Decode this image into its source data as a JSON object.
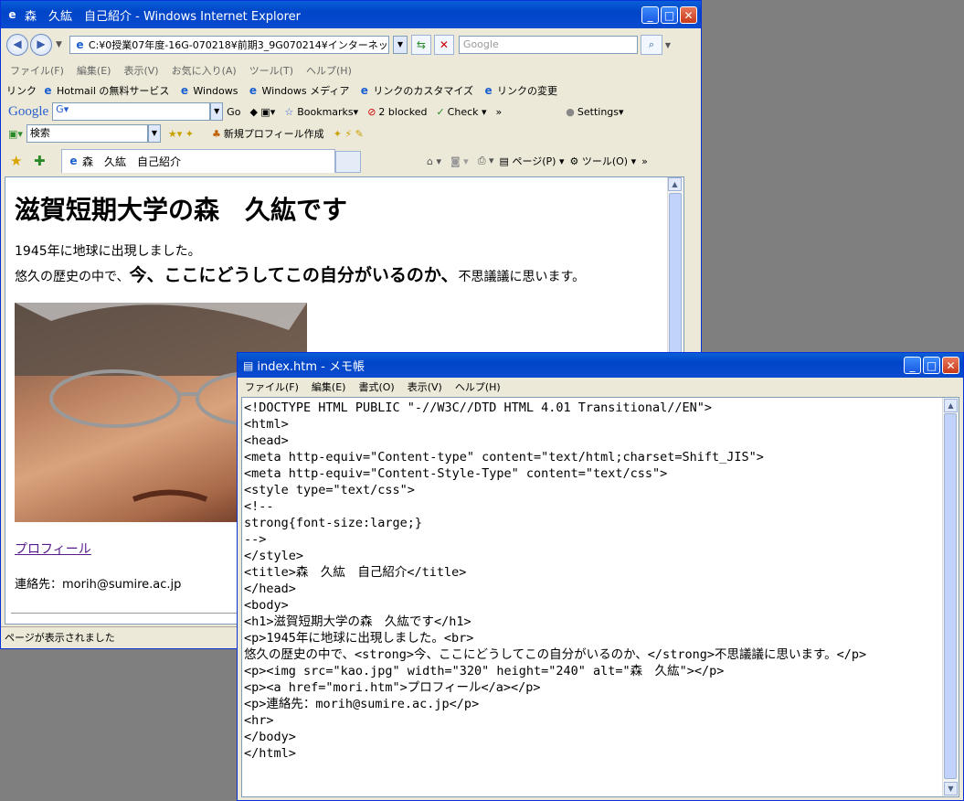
{
  "ie": {
    "title": "森　久紘　自己紹介 - Windows Internet Explorer",
    "address": "C:¥0授業07年度-16G-070218¥前期3_9G070214¥インターネット演習2",
    "search_placeholder": "Google",
    "menu": [
      "ファイル(F)",
      "編集(E)",
      "表示(V)",
      "お気に入り(A)",
      "ツール(T)",
      "ヘルプ(H)"
    ],
    "links_label": "リンク",
    "links": [
      "Hotmail の無料サービス",
      "Windows",
      "Windows メディア",
      "リンクのカスタマイズ",
      "リンクの変更"
    ],
    "google_toolbar": {
      "logo": "Google",
      "go": "Go",
      "bookmarks": "Bookmarks",
      "blocked": "2 blocked",
      "check": "Check",
      "settings": "Settings",
      "more": "»"
    },
    "search_toolbar": {
      "field": "検索",
      "profile": "新規プロフィール作成"
    },
    "tab_title": "森　久紘　自己紹介",
    "command_bar": {
      "page": "ページ(P)",
      "tools": "ツール(O)",
      "more": "»"
    },
    "status": "ページが表示されました",
    "page": {
      "h1": "滋賀短期大学の森　久紘です",
      "line1": "1945年に地球に出現しました。",
      "line2_before": "悠久の歴史の中で、",
      "line2_strong": "今、ここにどうしてこの自分がいるのか、",
      "line2_after": "不思議議に思います。",
      "link": "プロフィール",
      "contact": "連絡先：morih@sumire.ac.jp"
    }
  },
  "notepad": {
    "title": "index.htm - メモ帳",
    "menu": [
      "ファイル(F)",
      "編集(E)",
      "書式(O)",
      "表示(V)",
      "ヘルプ(H)"
    ],
    "lines": [
      "<!DOCTYPE HTML PUBLIC \"-//W3C//DTD HTML 4.01 Transitional//EN\">",
      "<html>",
      "<head>",
      "<meta http-equiv=\"Content-type\" content=\"text/html;charset=Shift_JIS\">",
      "<meta http-equiv=\"Content-Style-Type\" content=\"text/css\">",
      "<style type=\"text/css\">",
      "<!--",
      "strong{font-size:large;}",
      "-->",
      "</style>",
      "<title>森　久紘　自己紹介</title>",
      "</head>",
      "<body>",
      "<h1>滋賀短期大学の森　久紘です</h1>",
      "<p>1945年に地球に出現しました。<br>",
      "悠久の歴史の中で、<strong>今、ここにどうしてこの自分がいるのか、</strong>不思議議に思います。</p>",
      "<p><img src=\"kao.jpg\" width=\"320\" height=\"240\" alt=\"森　久紘\"></p>",
      "<p><a href=\"mori.htm\">プロフィール</a></p>",
      "<p>連絡先：morih@sumire.ac.jp</p>",
      "<hr>",
      "</body>",
      "</html>"
    ]
  }
}
